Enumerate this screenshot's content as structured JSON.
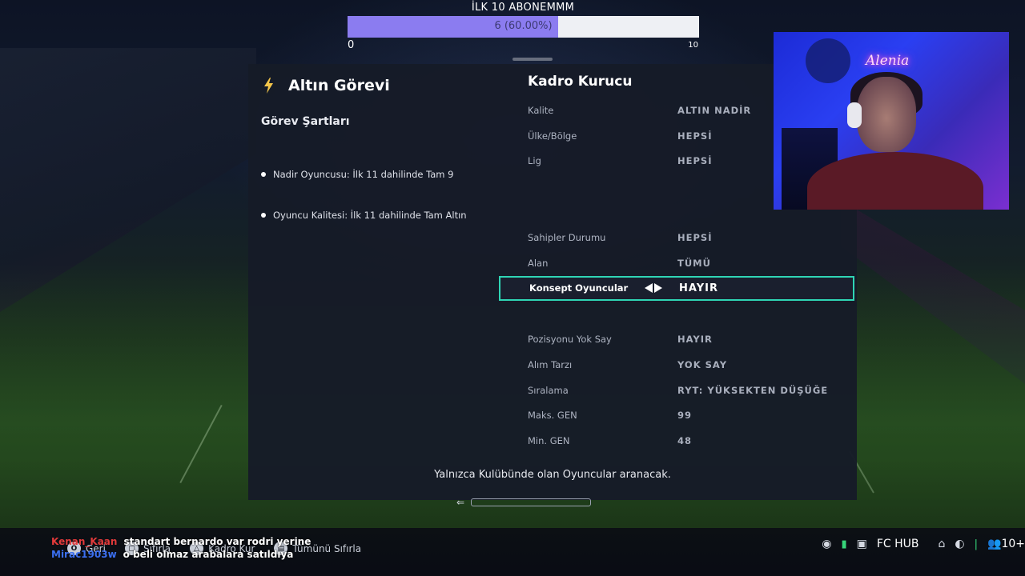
{
  "goal": {
    "title": "İLK 10 ABONEMMM",
    "value_text": "6 (60.00%)",
    "current": 6,
    "target": 10,
    "min_label": "0",
    "max_label": "10",
    "fill_percent": 60
  },
  "task": {
    "title": "Altın Görevi",
    "requirements_title": "Görev Şartları",
    "requirements": [
      "Nadir Oyuncusu: İlk 11 dahilinde Tam 9",
      "Oyuncu Kalitesi: İlk 11 dahilinde Tam Altın"
    ]
  },
  "squad_builder": {
    "title": "Kadro Kurucu",
    "filters": [
      {
        "label": "Kalite",
        "value": "ALTIN NADİR",
        "state": "normal"
      },
      {
        "label": "Ülke/Bölge",
        "value": "HEPSİ",
        "state": "normal"
      },
      {
        "label": "Lig",
        "value": "HEPSİ",
        "state": "normal"
      },
      {
        "label": "",
        "value": "",
        "state": "faint"
      },
      {
        "label": "",
        "value": "",
        "state": "faint"
      },
      {
        "label": "Sahipler Durumu",
        "value": "HEPSİ",
        "state": "normal"
      },
      {
        "label": "Alan",
        "value": "TÜMÜ",
        "state": "normal"
      },
      {
        "label": "Konsept Oyuncular",
        "value": "HAYIR",
        "state": "selected"
      },
      {
        "label": "",
        "value": "",
        "state": "faint"
      },
      {
        "label": "Pozisyonu Yok Say",
        "value": "HAYIR",
        "state": "normal"
      },
      {
        "label": "Alım Tarzı",
        "value": "YOK SAY",
        "state": "normal"
      },
      {
        "label": "Sıralama",
        "value": "RYT: YÜKSEKTEN DÜŞÜĞE",
        "state": "normal"
      },
      {
        "label": "Maks. GEN",
        "value": "99",
        "state": "normal"
      },
      {
        "label": "Min. GEN",
        "value": "48",
        "state": "normal"
      }
    ],
    "footer_note": "Yalnızca Kulübünde olan Oyuncular aranacak."
  },
  "webcam": {
    "neon_sign": "Alenia"
  },
  "nav_prompts": [
    {
      "glyph": "O",
      "label": "Geri"
    },
    {
      "glyph": "▢",
      "label": "Sıfırla"
    },
    {
      "glyph": "△",
      "label": "Kadro Kur"
    },
    {
      "glyph": "▤",
      "label": "Tümünü Sıfırla"
    }
  ],
  "chat": [
    {
      "user": "Kenan_Kaan",
      "message": "standart bernardo var rodri yerine"
    },
    {
      "user": "Mirac1903w",
      "message": "o beli olmaz arabalara satıldıya"
    }
  ],
  "status_bar": {
    "fc_hub_label": "FC HUB",
    "friends_count": "10+"
  },
  "colors": {
    "goal_fill": "#8b7cf0",
    "selection_outline": "#2fd5b4",
    "panel_bg": "#161b28"
  }
}
